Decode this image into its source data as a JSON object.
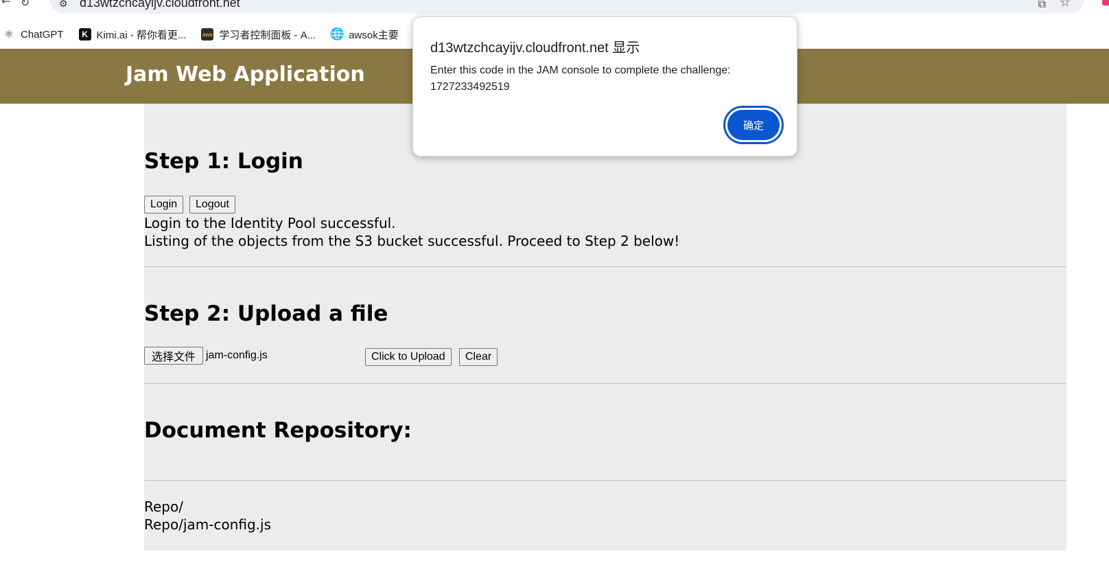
{
  "browser": {
    "url": "d13wtzchcayijv.cloudfront.net",
    "bookmarks": [
      {
        "label": "ChatGPT",
        "icon": "chatgpt-icon"
      },
      {
        "label": "Kimi.ai - 帮你看更...",
        "icon": "kimi-icon"
      },
      {
        "label": "学习者控制面板 - A...",
        "icon": "aws-icon"
      },
      {
        "label": "awsok主要",
        "icon": "globe-icon"
      }
    ]
  },
  "header": {
    "title": "Jam Web Application"
  },
  "step1": {
    "title": "Step 1: Login",
    "login_label": "Login",
    "logout_label": "Logout",
    "status_1": "Login to the Identity Pool successful.",
    "status_2": "Listing of the objects from the S3 bucket successful. Proceed to Step 2 below!"
  },
  "step2": {
    "title": "Step 2: Upload a file",
    "choose_file_label": "选择文件",
    "selected_file": "jam-config.js",
    "upload_label": "Click to Upload",
    "clear_label": "Clear"
  },
  "repo": {
    "title": "Document Repository:",
    "items": [
      "Repo/",
      "Repo/jam-config.js"
    ]
  },
  "dialog": {
    "title": "d13wtzchcayijv.cloudfront.net 显示",
    "message": "Enter this code in the JAM console to complete the challenge:",
    "code": "1727233492519",
    "ok_label": "确定"
  },
  "colors": {
    "header_bg": "#8a7843",
    "content_bg": "#ececec",
    "dialog_button": "#0b57d0"
  }
}
